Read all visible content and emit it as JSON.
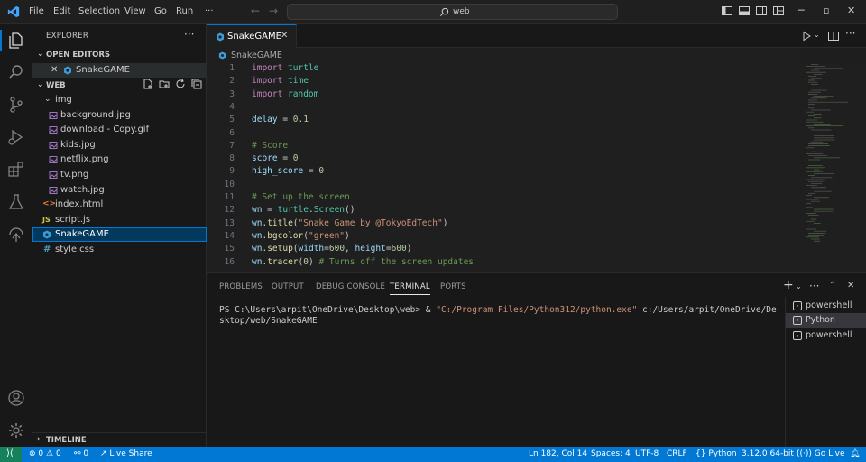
{
  "menu": {
    "file": "File",
    "edit": "Edit",
    "selection": "Selection",
    "view": "View",
    "go": "Go",
    "run": "Run",
    "more": "···"
  },
  "command_center": {
    "text": "web"
  },
  "sidebar": {
    "title": "EXPLORER",
    "open_editors_label": "OPEN EDITORS",
    "open_editor_file": "SnakeGAME",
    "workspace_label": "WEB",
    "items": [
      {
        "label": "img",
        "type": "folder"
      },
      {
        "label": "background.jpg",
        "type": "image"
      },
      {
        "label": "download - Copy.gif",
        "type": "image"
      },
      {
        "label": "kids.jpg",
        "type": "image"
      },
      {
        "label": "netflix.png",
        "type": "image"
      },
      {
        "label": "tv.png",
        "type": "image"
      },
      {
        "label": "watch.jpg",
        "type": "image"
      },
      {
        "label": "index.html",
        "type": "html"
      },
      {
        "label": "script.js",
        "type": "js"
      },
      {
        "label": "SnakeGAME",
        "type": "python"
      },
      {
        "label": "style.css",
        "type": "css"
      }
    ],
    "timeline_label": "TIMELINE"
  },
  "editor": {
    "tab_label": "SnakeGAME",
    "breadcrumb": "SnakeGAME",
    "line_numbers": [
      "1",
      "2",
      "3",
      "4",
      "5",
      "6",
      "7",
      "8",
      "9",
      "10",
      "11",
      "12",
      "13",
      "14",
      "15",
      "16"
    ],
    "code": {
      "l1_kw": "import",
      "l1_mod": " turtle",
      "l2_kw": "import",
      "l2_mod": " time",
      "l3_kw": "import",
      "l3_mod": " random",
      "l5_var": "delay",
      "l5_op": " = ",
      "l5_num": "0.1",
      "l7_cmt": "# Score",
      "l8_var": "score",
      "l8_op": " = ",
      "l8_num": "0",
      "l9_var": "high_score",
      "l9_op": " = ",
      "l9_num": "0",
      "l11_cmt": "# Set up the screen",
      "l12_var": "wn",
      "l12_op": " = ",
      "l12_mod": "turtle",
      "l12_dot": ".",
      "l12_fn": "Screen",
      "l12_p": "()",
      "l13_var": "wn",
      "l13_dot": ".",
      "l13_fn": "title",
      "l13_p1": "(",
      "l13_str": "\"Snake Game by @TokyoEdTech\"",
      "l13_p2": ")",
      "l14_var": "wn",
      "l14_dot": ".",
      "l14_fn": "bgcolor",
      "l14_p1": "(",
      "l14_str": "\"green\"",
      "l14_p2": ")",
      "l15_var": "wn",
      "l15_dot": ".",
      "l15_fn": "setup",
      "l15_p1": "(",
      "l15_a1": "width",
      "l15_eq1": "=",
      "l15_n1": "600",
      "l15_c": ", ",
      "l15_a2": "height",
      "l15_eq2": "=",
      "l15_n2": "600",
      "l15_p2": ")",
      "l16_var": "wn",
      "l16_dot": ".",
      "l16_fn": "tracer",
      "l16_p1": "(",
      "l16_n": "0",
      "l16_p2": ") ",
      "l16_cmt": "# Turns off the screen updates"
    }
  },
  "panel": {
    "tabs": [
      "PROBLEMS",
      "OUTPUT",
      "DEBUG CONSOLE",
      "TERMINAL",
      "PORTS"
    ],
    "active_tab": "TERMINAL",
    "terminal_prompt": "PS C:\\Users\\arpit\\OneDrive\\Desktop\\web> ",
    "terminal_amp": "& ",
    "terminal_exe": "\"C:/Program Files/Python312/python.exe\"",
    "terminal_arg": " c:/Users/arpit/OneDrive/Desktop/web/SnakeGAME",
    "terminals": [
      "powershell",
      "Python",
      "powershell"
    ],
    "active_terminal": "Python"
  },
  "statusbar": {
    "errors": "0",
    "warnings": "0",
    "ports": "0",
    "live_share": "Live Share",
    "cursor": "Ln 182, Col 14",
    "spaces": "Spaces: 4",
    "encoding": "UTF-8",
    "eol": "CRLF",
    "language": "Python",
    "interpreter": "3.12.0 64-bit",
    "go_live": "Go Live"
  },
  "colors": {
    "accent": "#0078d4",
    "remote": "#16825d",
    "keyword": "#c586c0",
    "string": "#ce9178",
    "comment": "#6a9955",
    "number": "#b5cea8"
  }
}
